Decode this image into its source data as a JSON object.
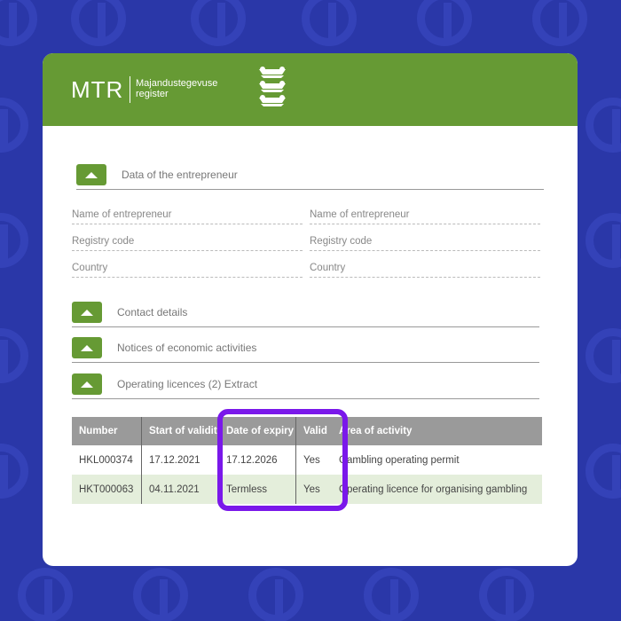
{
  "header": {
    "logo_main": "MTR",
    "logo_sub_line1": "Majandustegevuse",
    "logo_sub_line2": "register",
    "coat_icon": "coat-of-arms-icon"
  },
  "sections": {
    "entrepreneur": "Data of the entrepreneur",
    "contact": "Contact details",
    "notices": "Notices of economic activities",
    "licences": "Operating licences (2) Extract"
  },
  "fields": {
    "left": [
      "Name of entrepreneur",
      "Registry code",
      "Country"
    ],
    "right": [
      "Name of entrepreneur",
      "Registry code",
      "Country"
    ]
  },
  "table": {
    "headers": [
      "Number",
      "Start of validity",
      "Date of expiry",
      "Valid",
      "Area of activity"
    ],
    "rows": [
      [
        "HKL000374",
        "17.12.2021",
        "17.12.2026",
        "Yes",
        "Gambling operating permit"
      ],
      [
        "HKT000063",
        "04.11.2021",
        "Termless",
        "Yes",
        "Operating licence for organising gambling"
      ]
    ]
  },
  "colors": {
    "background": "#2a37a8",
    "brand_green": "#669a34",
    "highlight": "#7a18ea",
    "table_header": "#9a9a9a",
    "row_alt": "#e4eedb"
  }
}
